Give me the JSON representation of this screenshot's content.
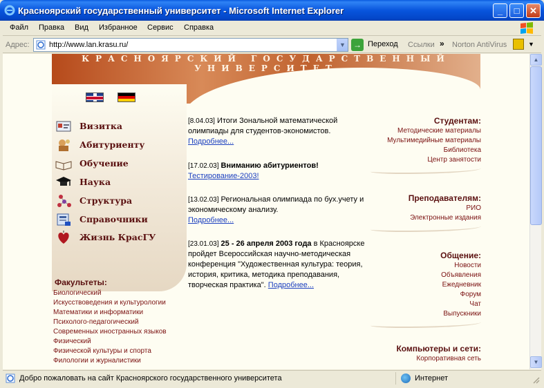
{
  "window": {
    "title": "Красноярский государственный университет - Microsoft Internet Explorer",
    "minimize": "_",
    "maximize": "□",
    "close": "✕"
  },
  "menu": [
    "Файл",
    "Правка",
    "Вид",
    "Избранное",
    "Сервис",
    "Справка"
  ],
  "address_bar": {
    "label": "Адрес:",
    "url": "http://www.lan.krasu.ru/",
    "go_label": "Переход",
    "links_label": "Ссылки",
    "links_more": "»",
    "norton_label": "Norton AntiVirus"
  },
  "banner": {
    "title": "КРАСНОЯРСКИЙ ГОСУДАРСТВЕННЫЙ УНИВЕРСИТЕТ"
  },
  "nav": [
    {
      "label": "Визитка",
      "icon": "business-card-icon"
    },
    {
      "label": "Абитуриенту",
      "icon": "applicant-icon"
    },
    {
      "label": "Обучение",
      "icon": "open-book-icon"
    },
    {
      "label": "Наука",
      "icon": "graduation-cap-icon"
    },
    {
      "label": "Структура",
      "icon": "molecule-icon"
    },
    {
      "label": "Справочники",
      "icon": "directory-icon"
    },
    {
      "label": "Жизнь КрасГУ",
      "icon": "heart-icon"
    }
  ],
  "faculties": {
    "title": "Факультеты:",
    "items": [
      "Биологический",
      "Искусствоведения и культурологии",
      "Математики и информатики",
      "Психолого-педагогический",
      "Современных иностранных языков",
      "Физический",
      "Физической культуры и спорта",
      "Филологии и журналистики"
    ]
  },
  "news": [
    {
      "date": "[8.04.03]",
      "text": " Итоги Зональной математической олимпиады для студентов-экономистов.",
      "bold": "",
      "link": "Подробнее..."
    },
    {
      "date": "[17.02.03]",
      "text": "",
      "bold": " Вниманию абитуриентов!",
      "link": "Тестирование-2003!"
    },
    {
      "date": "[13.02.03]",
      "text": " Региональная олимпиада по бух.учету и экономическому анализу.",
      "bold": "",
      "link": "Подробнее..."
    },
    {
      "date": "[23.01.03]",
      "text": " в Красноярске пройдет Всероссийская научно-методическая конференция \"Художественная культура: теория, история, критика, методика преподавания, творческая практика\". ",
      "bold": " 25 - 26 апреля 2003 года",
      "link": "Подробнее..."
    }
  ],
  "right_blocks": [
    {
      "title": "Студентам:",
      "links": [
        "Методические материалы",
        "Мультимедийные материалы",
        "Библиотека",
        "Центр занятости"
      ]
    },
    {
      "title": "Преподавателям:",
      "links": [
        "РИО",
        "Электронные издания"
      ]
    },
    {
      "title": "Общение:",
      "links": [
        "Новости",
        "Объявления",
        "Ежедневник",
        "Форум",
        "Чат",
        "Выпускники"
      ]
    },
    {
      "title": "Компьютеры и сети:",
      "links": [
        "Корпоративная сеть"
      ]
    }
  ],
  "status": {
    "text": "Добро пожаловать на сайт Красноярского государственного университета",
    "zone": "Интернет"
  },
  "colors": {
    "title_bar": "#0855dd",
    "nav_text": "#5a1010",
    "link_blue": "#1a3ebf",
    "page_bg": "#fefdf2"
  }
}
